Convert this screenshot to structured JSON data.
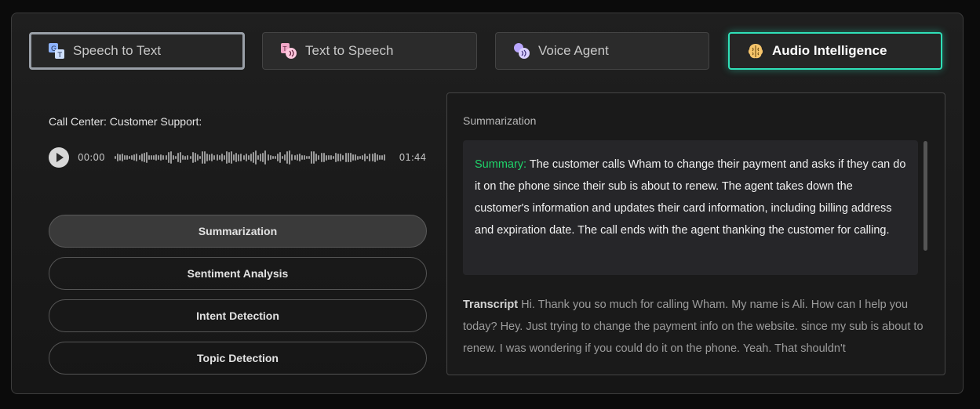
{
  "tabs": [
    {
      "label": "Speech to Text",
      "icon": "speech-to-text-icon"
    },
    {
      "label": "Text to Speech",
      "icon": "text-to-speech-icon"
    },
    {
      "label": "Voice Agent",
      "icon": "voice-agent-icon"
    },
    {
      "label": "Audio Intelligence",
      "icon": "brain-icon"
    }
  ],
  "colors": {
    "accent": "#2fe0b8",
    "summary_label": "#1fd36a",
    "background": "#161616"
  },
  "player": {
    "title": "Call Center: Customer Support:",
    "current_time": "00:00",
    "duration": "01:44"
  },
  "options": [
    {
      "label": "Summarization"
    },
    {
      "label": "Sentiment Analysis"
    },
    {
      "label": "Intent Detection"
    },
    {
      "label": "Topic Detection"
    }
  ],
  "result": {
    "title": "Summarization",
    "summary_label": "Summary:",
    "summary_text": "The customer calls Wham to change their payment and asks if they can do it on the phone since their sub is about to renew. The agent takes down the customer's information and updates their card information, including billing address and expiration date. The call ends with the agent thanking the customer for calling.",
    "transcript_label": "Transcript",
    "transcript_text": "Hi. Thank you so much for calling Wham. My name is Ali. How can I help you today? Hey. Just trying to change the payment info on the website. since my sub is about to renew. I was wondering if you could do it on the phone. Yeah. That shouldn't"
  }
}
